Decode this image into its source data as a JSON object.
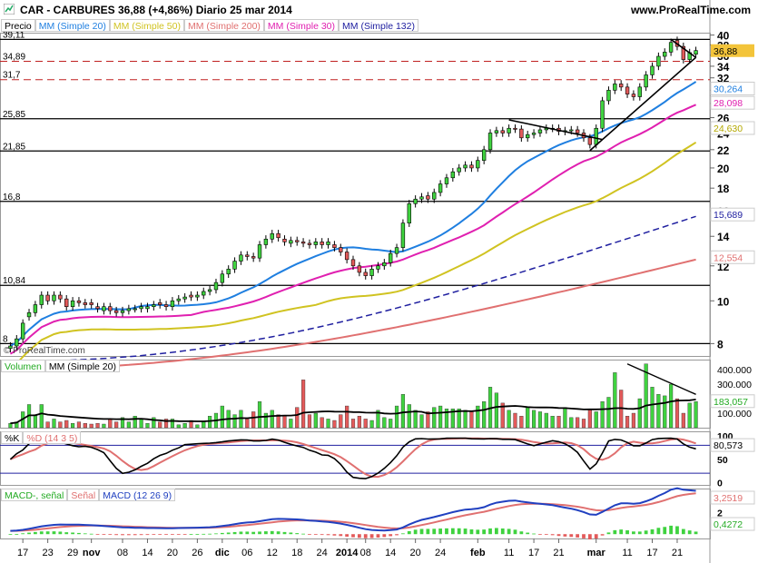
{
  "header": {
    "title": "CAR - CARBURES    36,88 (+4,86%)    Diario  25 mar 2014",
    "site": "www.ProRealTime.com"
  },
  "watermark": "© ProRealTime.com",
  "colors": {
    "up": "#3fd23f",
    "down": "#e35a5a",
    "ma20": "#1f7fe0",
    "ma50": "#d0c321",
    "ma200": "#e07070",
    "ma30": "#e020b0",
    "ma132": "#2020a0",
    "volMa": "#000000",
    "k": "#000000",
    "d": "#e07070",
    "macd": "#2040c0",
    "signal": "#e07070",
    "hist": "#3fd23f"
  },
  "price_panel": {
    "legend": [
      "Precio",
      "MM (Simple 20)",
      "MM (Simple 50)",
      "MM (Simple 200)",
      "MM (Simple 30)",
      "MM (Simple 132)"
    ],
    "ylim": [
      7.5,
      40.5
    ],
    "log": true,
    "y_ticks": [
      8,
      10,
      12,
      14,
      16,
      18,
      20,
      22,
      24,
      26,
      28,
      30,
      32,
      34,
      36,
      38,
      40
    ],
    "h_levels": [
      {
        "v": 39.11,
        "label": "39,11",
        "style": "solid"
      },
      {
        "v": 34.89,
        "label": "34,89",
        "style": "dash"
      },
      {
        "v": 31.7,
        "label": "31,7",
        "style": "dash"
      },
      {
        "v": 25.85,
        "label": "25,85",
        "style": "solid"
      },
      {
        "v": 21.85,
        "label": "21,85",
        "style": "solid"
      },
      {
        "v": 16.8,
        "label": "16,8",
        "style": "solid"
      },
      {
        "v": 10.84,
        "label": "10,84",
        "style": "solid"
      },
      {
        "v": 8,
        "label": "8",
        "style": "solid"
      }
    ],
    "right_labels": [
      {
        "v": 36.88,
        "text": "36,88",
        "bg": "#f3c43a"
      },
      {
        "v": 30.264,
        "text": "30,264",
        "color": "#1f7fe0"
      },
      {
        "v": 28.098,
        "text": "28,098",
        "color": "#e020b0"
      },
      {
        "v": 24.63,
        "text": "24,630",
        "color": "#b3a800"
      },
      {
        "v": 15.689,
        "text": "15,689",
        "color": "#2020a0"
      },
      {
        "v": 12.554,
        "text": "12,554",
        "color": "#e07070"
      }
    ]
  },
  "volume_panel": {
    "legend": [
      "Volumen",
      "MM (Simple 20)"
    ],
    "ylim": [
      0,
      470000
    ],
    "y_ticks": [
      {
        "v": 400000,
        "label": "400.000"
      },
      {
        "v": 300000,
        "label": "300.000"
      },
      {
        "v": 200000,
        "label": "200.000"
      },
      {
        "v": 100000,
        "label": "100.000"
      }
    ],
    "current_label": "183,057"
  },
  "stoch_panel": {
    "legend": [
      "%K",
      "%D (14 3 5)"
    ],
    "ylim": [
      -5,
      110
    ],
    "y_ticks": [
      {
        "v": 100,
        "label": "100"
      },
      {
        "v": 50,
        "label": "50"
      },
      {
        "v": 0,
        "label": "0"
      }
    ],
    "current_label": "80,573"
  },
  "macd_panel": {
    "legend": [
      "MACD-, señal",
      "Señal",
      "MACD (12 26 9)"
    ],
    "ylim": [
      -0.4,
      4.2
    ],
    "y_ticks": [
      {
        "v": 2,
        "label": "2"
      }
    ],
    "labels": [
      {
        "text": "3,2519",
        "color": "#e07070"
      },
      {
        "text": "0,4272",
        "color": "#22aa22"
      }
    ]
  },
  "x_axis": {
    "labels": [
      {
        "i": 2,
        "text": "17"
      },
      {
        "i": 6,
        "text": "23"
      },
      {
        "i": 10,
        "text": "29"
      },
      {
        "i": 13,
        "text": "nov",
        "bold": true
      },
      {
        "i": 18,
        "text": "08"
      },
      {
        "i": 22,
        "text": "14"
      },
      {
        "i": 26,
        "text": "20"
      },
      {
        "i": 30,
        "text": "26"
      },
      {
        "i": 34,
        "text": "dic",
        "bold": true
      },
      {
        "i": 38,
        "text": "06"
      },
      {
        "i": 42,
        "text": "12"
      },
      {
        "i": 46,
        "text": "18"
      },
      {
        "i": 50,
        "text": "24"
      },
      {
        "i": 54,
        "text": "2014",
        "bold": true
      },
      {
        "i": 57,
        "text": "08"
      },
      {
        "i": 61,
        "text": "14"
      },
      {
        "i": 65,
        "text": "20"
      },
      {
        "i": 69,
        "text": "24"
      },
      {
        "i": 75,
        "text": "feb",
        "bold": true
      },
      {
        "i": 80,
        "text": "11"
      },
      {
        "i": 84,
        "text": "17"
      },
      {
        "i": 88,
        "text": "21"
      },
      {
        "i": 94,
        "text": "mar",
        "bold": true
      },
      {
        "i": 99,
        "text": "11"
      },
      {
        "i": 103,
        "text": "17"
      },
      {
        "i": 107,
        "text": "21"
      }
    ]
  },
  "chart_data": {
    "type": "candlestick",
    "title": "CAR - CARBURES",
    "close": [
      7.9,
      8.2,
      8.9,
      9.4,
      9.8,
      10.3,
      10.0,
      10.3,
      10.1,
      9.7,
      10.0,
      9.9,
      9.8,
      9.8,
      9.6,
      9.7,
      9.5,
      9.4,
      9.5,
      9.6,
      9.6,
      9.7,
      9.7,
      9.8,
      9.8,
      9.7,
      10.0,
      10.1,
      10.2,
      10.2,
      10.3,
      10.5,
      10.6,
      11.0,
      11.5,
      11.8,
      12.3,
      12.7,
      12.6,
      12.5,
      13.4,
      13.8,
      14.2,
      13.9,
      13.6,
      13.7,
      13.6,
      13.5,
      13.4,
      13.6,
      13.4,
      13.6,
      13.2,
      12.9,
      12.4,
      12.0,
      11.6,
      11.4,
      11.8,
      12.0,
      12.2,
      12.8,
      13.2,
      15.0,
      16.6,
      17.0,
      17.2,
      17.0,
      17.6,
      18.4,
      19.0,
      19.6,
      20.0,
      20.3,
      20.0,
      20.8,
      22.0,
      24.0,
      24.3,
      24.0,
      24.6,
      24.5,
      23.4,
      23.8,
      24.0,
      24.4,
      24.6,
      24.6,
      24.2,
      24.3,
      24.4,
      24.0,
      23.4,
      22.6,
      24.6,
      28.4,
      30.0,
      31.0,
      30.5,
      29.4,
      29.0,
      30.5,
      32.5,
      34.0,
      35.8,
      36.6,
      38.5,
      37.7,
      35.2,
      36.5,
      36.9
    ],
    "open": [
      7.8,
      7.9,
      8.2,
      9.2,
      9.4,
      9.8,
      10.3,
      10.0,
      10.3,
      10.1,
      9.7,
      10.0,
      9.9,
      9.9,
      9.7,
      9.5,
      9.7,
      9.5,
      9.4,
      9.5,
      9.6,
      9.6,
      9.6,
      9.7,
      9.9,
      9.8,
      9.7,
      10.0,
      10.1,
      10.3,
      10.2,
      10.3,
      10.5,
      10.6,
      11.0,
      11.5,
      11.8,
      12.3,
      12.7,
      12.6,
      12.5,
      13.4,
      13.8,
      14.2,
      13.8,
      13.5,
      13.7,
      13.6,
      13.5,
      13.4,
      13.6,
      13.4,
      13.4,
      13.2,
      12.9,
      12.4,
      12.0,
      11.6,
      11.4,
      11.8,
      12.0,
      12.2,
      12.8,
      13.2,
      15.0,
      16.6,
      17.0,
      17.3,
      17.0,
      17.6,
      18.4,
      19.0,
      19.6,
      20.0,
      20.3,
      20.0,
      20.8,
      22.0,
      24.0,
      24.3,
      24.0,
      24.6,
      24.5,
      23.4,
      23.8,
      24.0,
      24.4,
      24.6,
      24.6,
      24.2,
      24.3,
      24.4,
      24.0,
      23.4,
      22.6,
      24.6,
      28.4,
      30.0,
      31.0,
      30.5,
      29.4,
      29.0,
      30.5,
      32.5,
      34.0,
      35.8,
      36.6,
      38.9,
      37.7,
      35.2,
      36.2
    ],
    "volume": [
      30000,
      40000,
      110000,
      160000,
      90000,
      160000,
      40000,
      60000,
      40000,
      50000,
      30000,
      40000,
      30000,
      25000,
      30000,
      25000,
      60000,
      40000,
      70000,
      40000,
      80000,
      60000,
      30000,
      70000,
      40000,
      60000,
      60000,
      20000,
      30000,
      50000,
      20000,
      40000,
      80000,
      100000,
      150000,
      120000,
      90000,
      120000,
      60000,
      110000,
      180000,
      100000,
      120000,
      90000,
      80000,
      60000,
      140000,
      330000,
      90000,
      100000,
      70000,
      60000,
      50000,
      90000,
      150000,
      60000,
      80000,
      60000,
      50000,
      120000,
      70000,
      60000,
      150000,
      230000,
      160000,
      120000,
      90000,
      110000,
      140000,
      150000,
      130000,
      130000,
      130000,
      120000,
      110000,
      150000,
      180000,
      280000,
      240000,
      170000,
      120000,
      100000,
      80000,
      140000,
      120000,
      110000,
      100000,
      80000,
      80000,
      140000,
      70000,
      70000,
      60000,
      130000,
      110000,
      180000,
      210000,
      380000,
      260000,
      80000,
      100000,
      200000,
      440000,
      280000,
      230000,
      220000,
      300000,
      200000,
      100000,
      170000,
      180000
    ],
    "ma20": null,
    "units": "EUR",
    "ylim": [
      7.5,
      40.5
    ]
  },
  "title": "CAR - CARBURES"
}
